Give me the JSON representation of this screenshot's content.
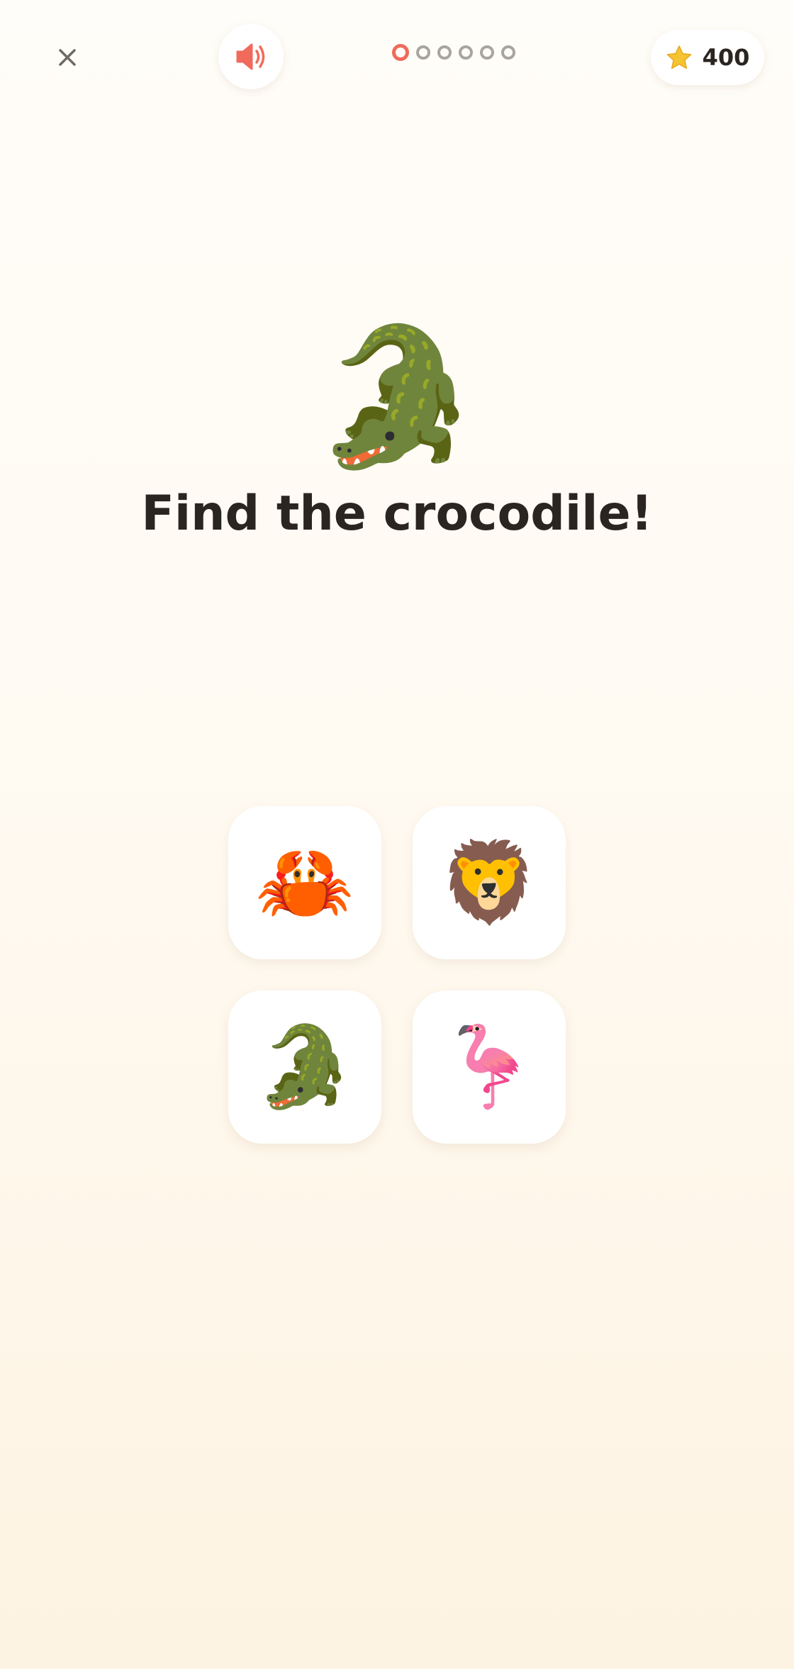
{
  "header": {
    "close_icon": "close-icon",
    "sound_icon": "speaker-icon",
    "progress": {
      "total": 6,
      "current": 1
    },
    "score": {
      "icon": "star-icon",
      "value": "400"
    }
  },
  "question": {
    "emoji": "🐊",
    "title": "Find the crocodile!"
  },
  "options": [
    {
      "emoji": "🦀",
      "name": "crab"
    },
    {
      "emoji": "🦁",
      "name": "lion"
    },
    {
      "emoji": "🐊",
      "name": "crocodile"
    },
    {
      "emoji": "🦩",
      "name": "flamingo"
    }
  ],
  "colors": {
    "accent": "#f06b5c",
    "dot_inactive": "#a9a4a2",
    "star": "#f6c431",
    "text": "#2b2522",
    "background": "#fffaf2"
  }
}
